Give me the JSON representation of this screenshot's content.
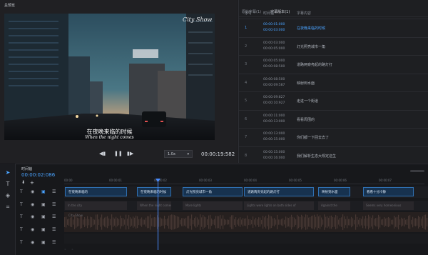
{
  "preview": {
    "title": "总预览",
    "overlay_text": "City Show",
    "subtitle_cn": "在夜晚来临的时候",
    "subtitle_en": "When the night comes",
    "speed": "1.0x",
    "timecode": "00:00:19:582"
  },
  "subtitle_list": {
    "tabs": [
      "原始字幕(1)",
      "字幕版本(1)"
    ],
    "columns": [
      "序号",
      "时间轴",
      "字幕内容"
    ],
    "rows": [
      {
        "index": "1",
        "start": "00:00:01:000",
        "end": "00:00:03:000",
        "text": "在夜晚来临的时候",
        "active": true
      },
      {
        "index": "2",
        "start": "00:00:03:000",
        "end": "00:00:05:000",
        "text": "灯光照亮城市一角",
        "active": false
      },
      {
        "index": "3",
        "start": "00:00:05:000",
        "end": "00:00:08:500",
        "text": "道路两旁亮起的路灯打",
        "active": false
      },
      {
        "index": "4",
        "start": "00:00:08:500",
        "end": "00:00:09:587",
        "text": "映射到水面",
        "active": false
      },
      {
        "index": "5",
        "start": "00:00:09:827",
        "end": "00:00:10:927",
        "text": "走进一个街道",
        "active": false
      },
      {
        "index": "6",
        "start": "00:00:11:000",
        "end": "00:00:13:000",
        "text": "看看周围的",
        "active": false
      },
      {
        "index": "7",
        "start": "00:00:13:000",
        "end": "00:00:15:000",
        "text": "你们都一下回去去了",
        "active": false
      },
      {
        "index": "8",
        "start": "00:00:15:000",
        "end": "00:00:16:000",
        "text": "我们解析生态大规定这生",
        "active": false
      }
    ]
  },
  "timeline": {
    "title": "时间轴",
    "current_time": "00:00:02:086",
    "ruler_ticks": [
      "00:00",
      "00:00:01",
      "00:00:02",
      "00:00:03",
      "00:00:04",
      "00:00:05",
      "00:00:06",
      "00:00:07",
      "00:00:08"
    ],
    "subtitle_clips": [
      "在夜晚来临的",
      "在夜晚来临的时候",
      "灯光照亮城市一角",
      "道路两旁亮起的路灯打",
      "映射到水面",
      "看看十分冷静"
    ],
    "translation_clips": [
      "In the city",
      "When the night comes",
      "More lights",
      "Lights were lights on both sides of",
      "Against the",
      "Seems very homeonious"
    ],
    "audio_label": "City Show"
  },
  "colors": {
    "accent": "#4aa3ff",
    "clip_border": "#2f6fb0",
    "clip_bg": "#17324f",
    "playhead": "#4a8cff"
  }
}
